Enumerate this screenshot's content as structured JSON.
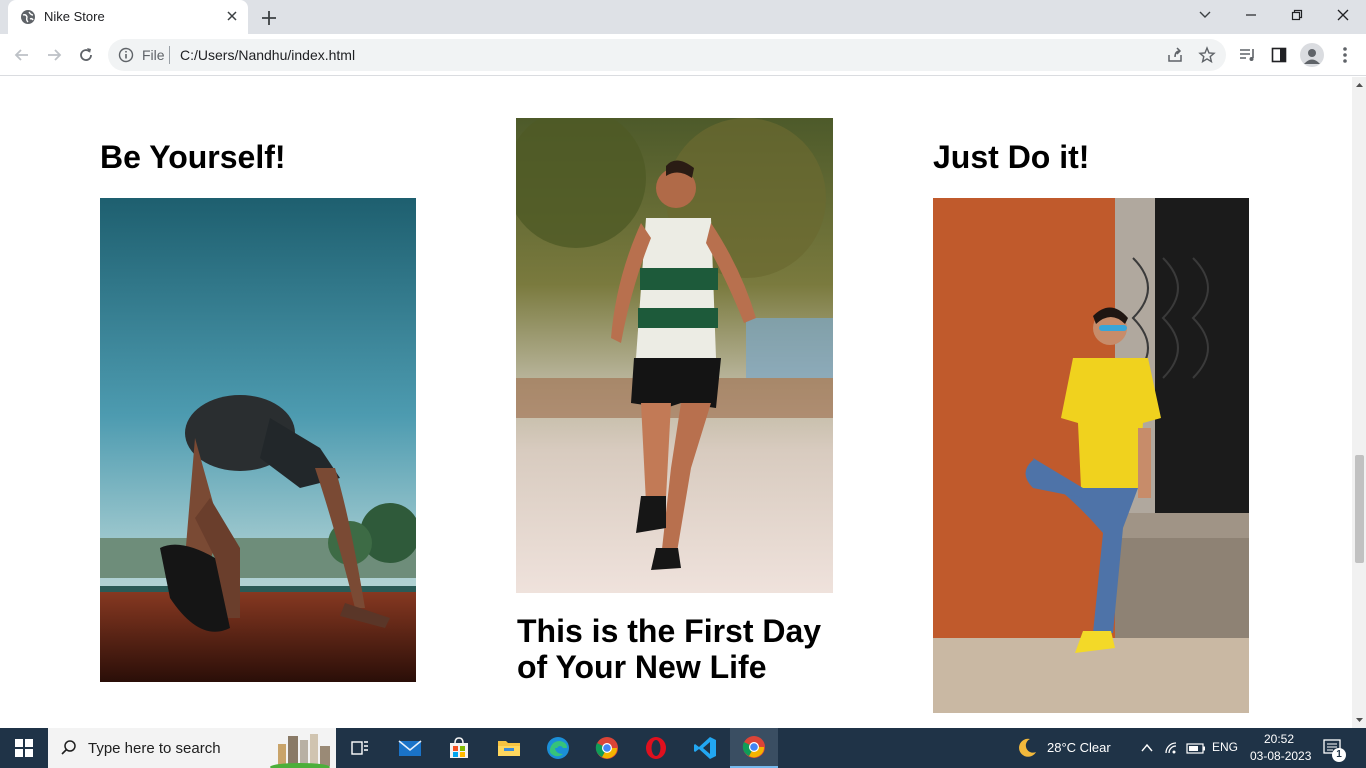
{
  "browser": {
    "tab_title": "Nike Store",
    "scheme_label": "File",
    "url": "C:/Users/Nandhu/index.html"
  },
  "page": {
    "cards": [
      {
        "heading": "Be Yourself!",
        "image": "sprinter-at-starting-line"
      },
      {
        "heading": "This is the First Day of Your New Life",
        "image": "runner-jogging"
      },
      {
        "heading": "Just Do it!",
        "image": "man-in-yellow-shirt-leaning-on-wall"
      }
    ]
  },
  "taskbar": {
    "search_placeholder": "Type here to search",
    "weather": "28°C  Clear",
    "language": "ENG",
    "time": "20:52",
    "date": "03-08-2023",
    "notification_count": "1"
  },
  "colors": {
    "tabbar_bg": "#dee1e6",
    "taskbar_bg": "#1f3347",
    "accent": "#76b9ed"
  }
}
